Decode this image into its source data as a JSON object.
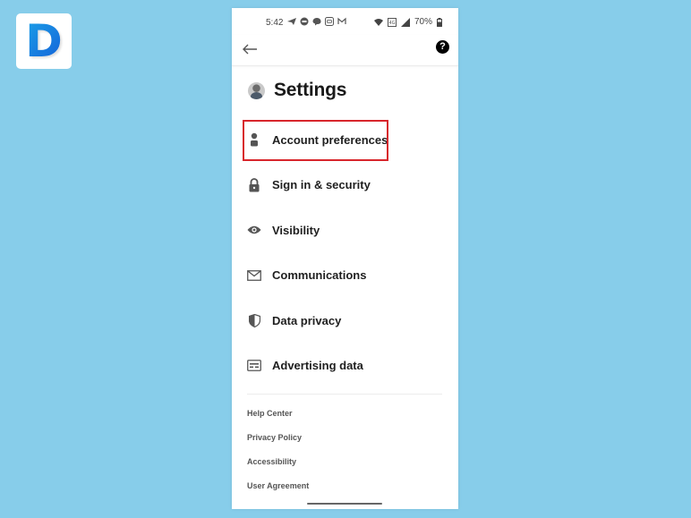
{
  "brand": {
    "logo_letter": "D"
  },
  "status_bar": {
    "time": "5:42",
    "notification_icons": [
      "telegram-icon",
      "chat-bubble-icon",
      "message-icon",
      "app-icon",
      "gmail-icon"
    ],
    "system_icons": [
      "wifi-icon",
      "volte-icon",
      "signal-icon"
    ],
    "battery": "70%"
  },
  "app_bar": {
    "back_label": "Back",
    "help_label": "?"
  },
  "page": {
    "title": "Settings"
  },
  "menu": {
    "items": [
      {
        "label": "Account preferences",
        "icon": "person-icon",
        "highlighted": true
      },
      {
        "label": "Sign in & security",
        "icon": "lock-icon"
      },
      {
        "label": "Visibility",
        "icon": "eye-icon"
      },
      {
        "label": "Communications",
        "icon": "envelope-icon"
      },
      {
        "label": "Data privacy",
        "icon": "shield-icon"
      },
      {
        "label": "Advertising data",
        "icon": "ad-card-icon"
      }
    ]
  },
  "footer": {
    "links": [
      "Help Center",
      "Privacy Policy",
      "Accessibility",
      "User Agreement"
    ]
  },
  "colors": {
    "background": "#87cdea",
    "highlight": "#d8262c",
    "logo_gradient_start": "#1aa0e8",
    "logo_gradient_end": "#1560d8"
  }
}
